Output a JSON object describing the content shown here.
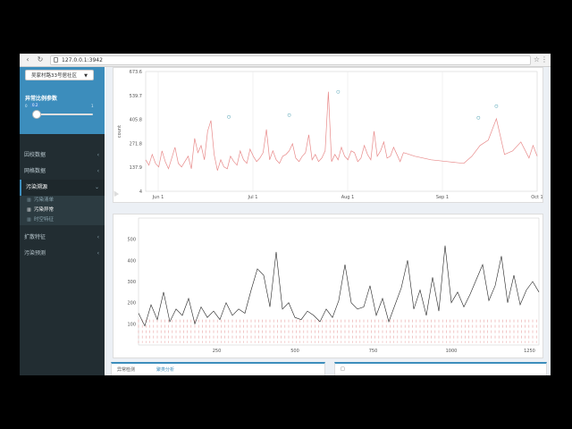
{
  "browser": {
    "url": "127.0.0.1:3942",
    "back_icon": "arrow-left-icon",
    "reload_icon": "reload-icon"
  },
  "sidebar": {
    "location_select": "吴家村路33号居社区",
    "param_title": "异常比例参数",
    "slider": {
      "min": "0",
      "value": "0.2",
      "max": "1",
      "fraction": 0.08
    },
    "items": [
      {
        "label": "因校数据",
        "chevron": "‹"
      },
      {
        "label": "网格数据",
        "chevron": "‹"
      },
      {
        "label": "污染溯源",
        "chevron": "⌄",
        "active": true
      },
      {
        "label": "扩散特征",
        "chevron": "‹"
      },
      {
        "label": "污染预测",
        "chevron": "‹"
      }
    ],
    "subitems": [
      {
        "label": "污染清单"
      },
      {
        "label": "污染异常",
        "current": true
      },
      {
        "label": "时空特征"
      }
    ]
  },
  "panels": {
    "bottom_left_tabs": [
      "异常检测",
      "聚类分析"
    ],
    "bottom_right_tab": "□"
  },
  "colors": {
    "accent": "#3c8dbc",
    "sidebar": "#222d32",
    "line_red": "#e88a8a",
    "line_black": "#222222"
  },
  "chart_data": [
    {
      "type": "line",
      "ylabel": "count",
      "yticks": [
        "4",
        "137.9",
        "271.8",
        "405.8",
        "539.7",
        "673.6"
      ],
      "ylim": [
        4,
        673.6
      ],
      "xticks": [
        "Jun 1",
        "Jul 1",
        "Aug 1",
        "Sep 1",
        "Oct 1"
      ],
      "series": [
        {
          "x": [
            0,
            4,
            8,
            12,
            16,
            20,
            24,
            28,
            32,
            36,
            40,
            44,
            48,
            52,
            56,
            60,
            64,
            68,
            72,
            76,
            80,
            84,
            88,
            92,
            96,
            100,
            104,
            108,
            112,
            116,
            120,
            124,
            128,
            132,
            136,
            140,
            144,
            148,
            152,
            156,
            160,
            164,
            168,
            172,
            176,
            180,
            184,
            188,
            192,
            196,
            200,
            204,
            208,
            212,
            216,
            220,
            224,
            228,
            232,
            236,
            240,
            244,
            248,
            252,
            256,
            260,
            264,
            268,
            272,
            276,
            280,
            284,
            288,
            292,
            296,
            300,
            304,
            308,
            312,
            316,
            320,
            330,
            340,
            350,
            360,
            370,
            380,
            390,
            400,
            410,
            420,
            430,
            440,
            450,
            460,
            470,
            475,
            480
          ],
          "values": [
            180,
            150,
            210,
            160,
            140,
            230,
            170,
            130,
            190,
            250,
            160,
            140,
            170,
            200,
            130,
            300,
            220,
            260,
            180,
            340,
            400,
            210,
            120,
            180,
            140,
            130,
            200,
            170,
            150,
            230,
            180,
            160,
            240,
            200,
            170,
            190,
            220,
            350,
            180,
            230,
            180,
            160,
            200,
            210,
            230,
            270,
            190,
            170,
            200,
            220,
            320,
            180,
            210,
            170,
            190,
            230,
            560,
            170,
            210,
            180,
            250,
            200,
            180,
            230,
            220,
            170,
            190,
            260,
            210,
            180,
            340,
            200,
            230,
            280,
            190,
            200,
            250,
            210,
            170,
            220,
            215,
            200,
            190,
            180,
            175,
            170,
            165,
            160,
            200,
            260,
            290,
            410,
            210,
            230,
            280,
            190,
            260,
            200
          ]
        }
      ],
      "markers": [
        {
          "x": 102,
          "y": 420
        },
        {
          "x": 176,
          "y": 430
        },
        {
          "x": 236,
          "y": 560
        },
        {
          "x": 408,
          "y": 415
        },
        {
          "x": 430,
          "y": 480
        }
      ]
    },
    {
      "type": "line",
      "yticks": [
        "100",
        "200",
        "300",
        "400",
        "500"
      ],
      "ylim": [
        0,
        600
      ],
      "xticks": [
        "250",
        "500",
        "750",
        "1000",
        "1250"
      ],
      "xlim": [
        0,
        1280
      ],
      "series": [
        {
          "x": [
            0,
            20,
            40,
            60,
            80,
            100,
            120,
            140,
            160,
            180,
            200,
            220,
            240,
            260,
            280,
            300,
            320,
            340,
            360,
            380,
            400,
            420,
            440,
            460,
            480,
            500,
            520,
            540,
            560,
            580,
            600,
            620,
            640,
            660,
            680,
            700,
            720,
            740,
            760,
            780,
            800,
            820,
            840,
            860,
            880,
            900,
            920,
            940,
            960,
            980,
            1000,
            1020,
            1040,
            1060,
            1080,
            1100,
            1120,
            1140,
            1160,
            1180,
            1200,
            1220,
            1240,
            1260,
            1280
          ],
          "values": [
            150,
            90,
            190,
            120,
            250,
            110,
            170,
            140,
            220,
            100,
            180,
            130,
            160,
            120,
            200,
            140,
            170,
            150,
            260,
            360,
            330,
            180,
            440,
            170,
            200,
            130,
            120,
            160,
            140,
            110,
            170,
            130,
            210,
            380,
            200,
            170,
            180,
            280,
            140,
            220,
            110,
            190,
            270,
            400,
            170,
            260,
            140,
            320,
            160,
            470,
            200,
            250,
            180,
            240,
            310,
            380,
            210,
            280,
            420,
            200,
            330,
            190,
            260,
            300,
            250
          ]
        }
      ]
    }
  ]
}
